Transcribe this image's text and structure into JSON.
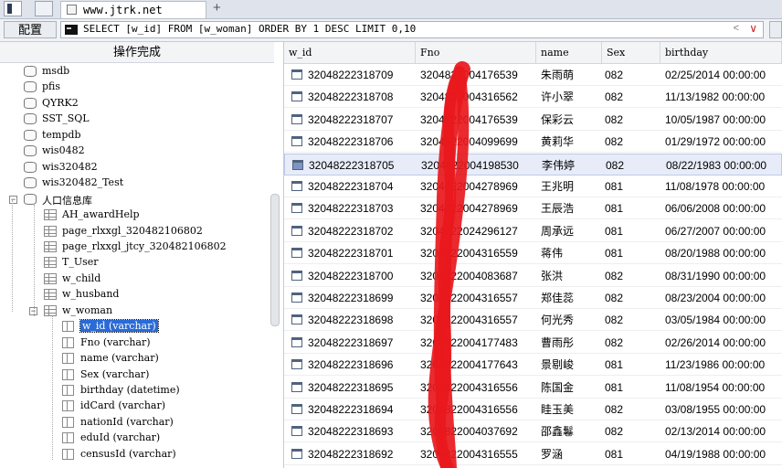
{
  "browser": {
    "tab_title": "www.jtrk.net",
    "new_tab_symbol": "+"
  },
  "toolbar": {
    "config_label": "配置",
    "sql": "SELECT [w_id] FROM [w_woman] ORDER BY 1 DESC LIMIT 0,10",
    "sql_tag": "<",
    "dropdown_symbol": "∨"
  },
  "left_panel": {
    "header": "操作完成",
    "tree": [
      {
        "label": "msdb",
        "type": "db",
        "level": 0
      },
      {
        "label": "pfis",
        "type": "db",
        "level": 0
      },
      {
        "label": "QYRK2",
        "type": "db",
        "level": 0
      },
      {
        "label": "SST_SQL",
        "type": "db",
        "level": 0
      },
      {
        "label": "tempdb",
        "type": "db",
        "level": 0
      },
      {
        "label": "wis0482",
        "type": "db",
        "level": 0
      },
      {
        "label": "wis320482",
        "type": "db",
        "level": 0
      },
      {
        "label": "wis320482_Test",
        "type": "db",
        "level": 0
      },
      {
        "label": "人口信息库",
        "type": "db",
        "level": 0,
        "expanded": true
      },
      {
        "label": "AH_awardHelp",
        "type": "table",
        "level": 1
      },
      {
        "label": "page_rlxxgl_320482106802",
        "type": "table",
        "level": 1
      },
      {
        "label": "page_rlxxgl_jtcy_320482106802",
        "type": "table",
        "level": 1
      },
      {
        "label": "T_User",
        "type": "table",
        "level": 1
      },
      {
        "label": "w_child",
        "type": "table",
        "level": 1
      },
      {
        "label": "w_husband",
        "type": "table",
        "level": 1
      },
      {
        "label": "w_woman",
        "type": "table",
        "level": 1,
        "expanded": true
      },
      {
        "label": "w_id (varchar)",
        "type": "column",
        "level": 2,
        "selected": true
      },
      {
        "label": "Fno (varchar)",
        "type": "column",
        "level": 2
      },
      {
        "label": "name (varchar)",
        "type": "column",
        "level": 2
      },
      {
        "label": "Sex (varchar)",
        "type": "column",
        "level": 2
      },
      {
        "label": "birthday (datetime)",
        "type": "column",
        "level": 2
      },
      {
        "label": "idCard (varchar)",
        "type": "column",
        "level": 2
      },
      {
        "label": "nationId (varchar)",
        "type": "column",
        "level": 2
      },
      {
        "label": "eduId (varchar)",
        "type": "column",
        "level": 2
      },
      {
        "label": "censusId (varchar)",
        "type": "column",
        "level": 2
      }
    ]
  },
  "grid": {
    "columns": [
      "w_id",
      "Fno",
      "name",
      "Sex",
      "birthday"
    ],
    "rows": [
      {
        "w_id": "32048222318709",
        "fno": "3204822004176539",
        "name": "朱雨萌",
        "sex": "082",
        "birthday": "02/25/2014 00:00:00"
      },
      {
        "w_id": "32048222318708",
        "fno": "3204822004316562",
        "name": "许小翠",
        "sex": "082",
        "birthday": "11/13/1982 00:00:00"
      },
      {
        "w_id": "32048222318707",
        "fno": "3204822004176539",
        "name": "保彩云",
        "sex": "082",
        "birthday": "10/05/1987 00:00:00"
      },
      {
        "w_id": "32048222318706",
        "fno": "3204822004099699",
        "name": "黄莉华",
        "sex": "082",
        "birthday": "01/29/1972 00:00:00"
      },
      {
        "w_id": "32048222318705",
        "fno": "3204822004198530",
        "name": "李伟婷",
        "sex": "082",
        "birthday": "08/22/1983 00:00:00",
        "selected": true
      },
      {
        "w_id": "32048222318704",
        "fno": "3204822004278969",
        "name": "王兆明",
        "sex": "081",
        "birthday": "11/08/1978 00:00:00"
      },
      {
        "w_id": "32048222318703",
        "fno": "3204822004278969",
        "name": "王辰浩",
        "sex": "081",
        "birthday": "06/06/2008 00:00:00"
      },
      {
        "w_id": "32048222318702",
        "fno": "3204822024296127",
        "name": "周承远",
        "sex": "081",
        "birthday": "06/27/2007 00:00:00"
      },
      {
        "w_id": "32048222318701",
        "fno": "3204822004316559",
        "name": "蒋伟",
        "sex": "081",
        "birthday": "08/20/1988 00:00:00"
      },
      {
        "w_id": "32048222318700",
        "fno": "3204822004083687",
        "name": "张洪",
        "sex": "082",
        "birthday": "08/31/1990 00:00:00"
      },
      {
        "w_id": "32048222318699",
        "fno": "3204822004316557",
        "name": "郑佳蕊",
        "sex": "082",
        "birthday": "08/23/2004 00:00:00"
      },
      {
        "w_id": "32048222318698",
        "fno": "3204822004316557",
        "name": "何光秀",
        "sex": "082",
        "birthday": "03/05/1984 00:00:00"
      },
      {
        "w_id": "32048222318697",
        "fno": "3204822004177483",
        "name": "曹雨彤",
        "sex": "082",
        "birthday": "02/26/2014 00:00:00"
      },
      {
        "w_id": "32048222318696",
        "fno": "3204822004177643",
        "name": "景剔峻",
        "sex": "081",
        "birthday": "11/23/1986 00:00:00"
      },
      {
        "w_id": "32048222318695",
        "fno": "3204822004316556",
        "name": "陈国金",
        "sex": "081",
        "birthday": "11/08/1954 00:00:00"
      },
      {
        "w_id": "32048222318694",
        "fno": "3204822004316556",
        "name": "眭玉美",
        "sex": "082",
        "birthday": "03/08/1955 00:00:00"
      },
      {
        "w_id": "32048222318693",
        "fno": "3204822004037692",
        "name": "邵鑫鬈",
        "sex": "082",
        "birthday": "02/13/2014 00:00:00"
      },
      {
        "w_id": "32048222318692",
        "fno": "3204822004316555",
        "name": "罗涵",
        "sex": "081",
        "birthday": "04/19/1988 00:00:00"
      }
    ]
  },
  "colors": {
    "selection": "#2a6bd6",
    "row_selected_bg": "#e7ecf8",
    "scribble": "#e8181c"
  }
}
